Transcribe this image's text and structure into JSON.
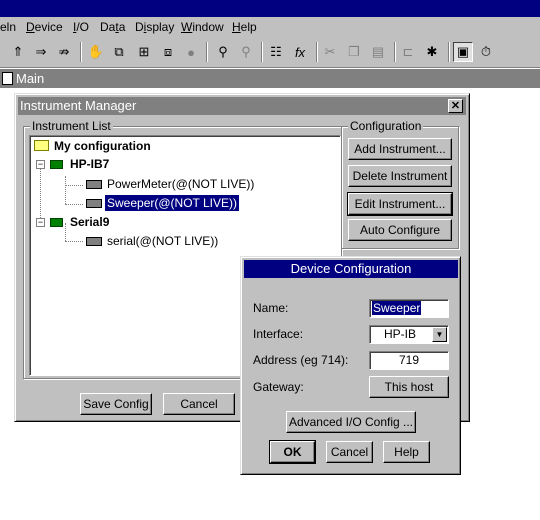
{
  "menubar": {
    "items": [
      "eln",
      "Device",
      "I/O",
      "Data",
      "Display",
      "Window",
      "Help"
    ],
    "underline": [
      "",
      "D",
      "I",
      "t",
      "i",
      "W",
      "H"
    ]
  },
  "toolbar": {
    "icons": [
      "open-icon",
      "save-icon",
      "save-as-icon",
      "hand-icon",
      "copy-icon",
      "move-icon",
      "clone-icon",
      "circle-icon",
      "find-icon",
      "find-next-icon",
      "properties-icon",
      "formula-icon",
      "cut-icon",
      "copy-edit-icon",
      "paste-icon",
      "connect-icon",
      "debug-icon",
      "panel-icon",
      "timer-icon"
    ]
  },
  "main_window": {
    "title": "Main"
  },
  "instrument_manager": {
    "title": "Instrument Manager",
    "close_label": "✕",
    "list_group_label": "Instrument List",
    "config_group_label": "Configuration",
    "tree": {
      "root": "My configuration",
      "hpib": "HP-IB7",
      "powermeter": "PowerMeter(@(NOT LIVE))",
      "sweeper": "Sweeper(@(NOT LIVE))",
      "serial": "Serial9",
      "serial_item": "serial(@(NOT LIVE))"
    },
    "buttons": {
      "add": "Add Instrument...",
      "delete": "Delete Instrument",
      "edit": "Edit Instrument...",
      "auto": "Auto Configure",
      "save": "Save Config",
      "cancel": "Cancel"
    }
  },
  "device_config": {
    "title": "Device Configuration",
    "name_label": "Name:",
    "name_value": "Sweeper",
    "interface_label": "Interface:",
    "interface_value": "HP-IB",
    "address_label": "Address (eg 714):",
    "address_value": "719",
    "gateway_label": "Gateway:",
    "gateway_value": "This host",
    "advanced": "Advanced I/O Config ...",
    "ok": "OK",
    "cancel": "Cancel",
    "help": "Help"
  },
  "colors": {
    "titlebar_active": "#000080",
    "titlebar_inactive": "#808080",
    "face": "#c0c0c0"
  }
}
